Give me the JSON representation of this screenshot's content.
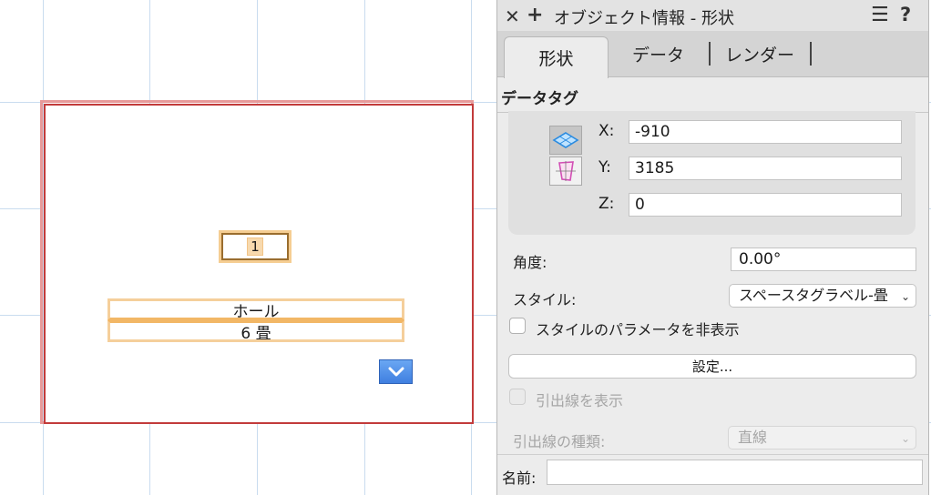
{
  "canvas": {
    "room_number": "1",
    "room_name": "ホール",
    "room_size": "6 畳"
  },
  "palette": {
    "title": "オブジェクト情報 - 形状",
    "close_icon": "close-icon",
    "add_icon": "plus-icon",
    "menu_icon": "hamburger-menu-icon",
    "help_label": "?",
    "tabs": [
      {
        "label": "形状",
        "active": true
      },
      {
        "label": "データ",
        "active": false
      },
      {
        "label": "レンダー",
        "active": false
      }
    ],
    "section_title": "データタグ",
    "coords": {
      "x_label": "X:",
      "x_value": "-910",
      "y_label": "Y:",
      "y_value": "3185",
      "z_label": "Z:",
      "z_value": "0"
    },
    "angle_label": "角度:",
    "angle_value": "0.00°",
    "style_label": "スタイル:",
    "style_value": "スペースタグラベル-畳",
    "hide_params_label": "スタイルのパラメータを非表示",
    "settings_button_label": "設定...",
    "show_leader_label": "引出線を表示",
    "leader_type_label": "引出線の種類:",
    "leader_type_value": "直線",
    "name_label": "名前:",
    "name_value": ""
  },
  "colors": {
    "room_outer": "#e79a9a",
    "room_inner": "#c23b3b",
    "tag_highlight": "#f5cd92",
    "grid": "#c9dcef",
    "accent_blue": "#3f7fe0"
  }
}
